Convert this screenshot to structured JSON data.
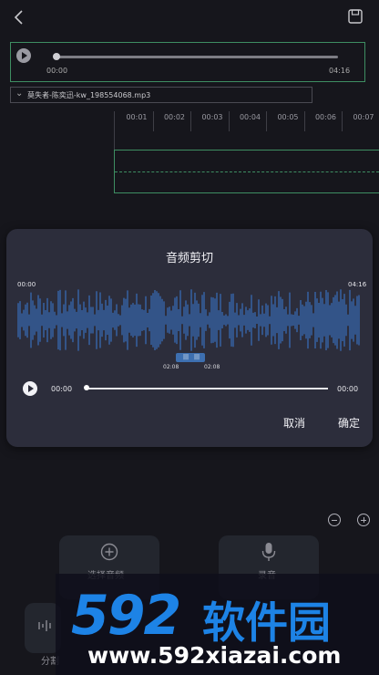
{
  "player": {
    "current_time": "00:00",
    "total_time": "04:16",
    "progress": 0
  },
  "file": {
    "name": "莫失者-陈奕迅-kw_198554068.mp3"
  },
  "timeline": {
    "ticks": [
      "00:01",
      "00:02",
      "00:03",
      "00:04",
      "00:05",
      "00:06",
      "00:07"
    ]
  },
  "dialog": {
    "title": "音频剪切",
    "wave_start": "00:00",
    "wave_end": "04:16",
    "selection_start": "02:08",
    "selection_end": "02:08",
    "play_current": "00:00",
    "play_total": "00:00",
    "cancel_label": "取消",
    "confirm_label": "确定"
  },
  "bottom": {
    "select_audio_label": "选择音频",
    "record_label": "录音",
    "split_label": "分割"
  },
  "watermark": {
    "logo": "592",
    "brand": "软件园",
    "url": "www.592xiazai.com"
  },
  "colors": {
    "background": "#16161c",
    "dialog": "#2c2d3b",
    "waveform": "#3a7bd5",
    "track_border": "#3e8e62",
    "watermark_blue": "#1d83e6"
  },
  "icons": {
    "back": "chevron-left-icon",
    "save": "save-icon",
    "zoom_out": "minus-circle-icon",
    "zoom_in": "plus-circle-icon",
    "select_audio": "plus-circle-icon",
    "record": "microphone-icon",
    "split": "split-icon"
  }
}
